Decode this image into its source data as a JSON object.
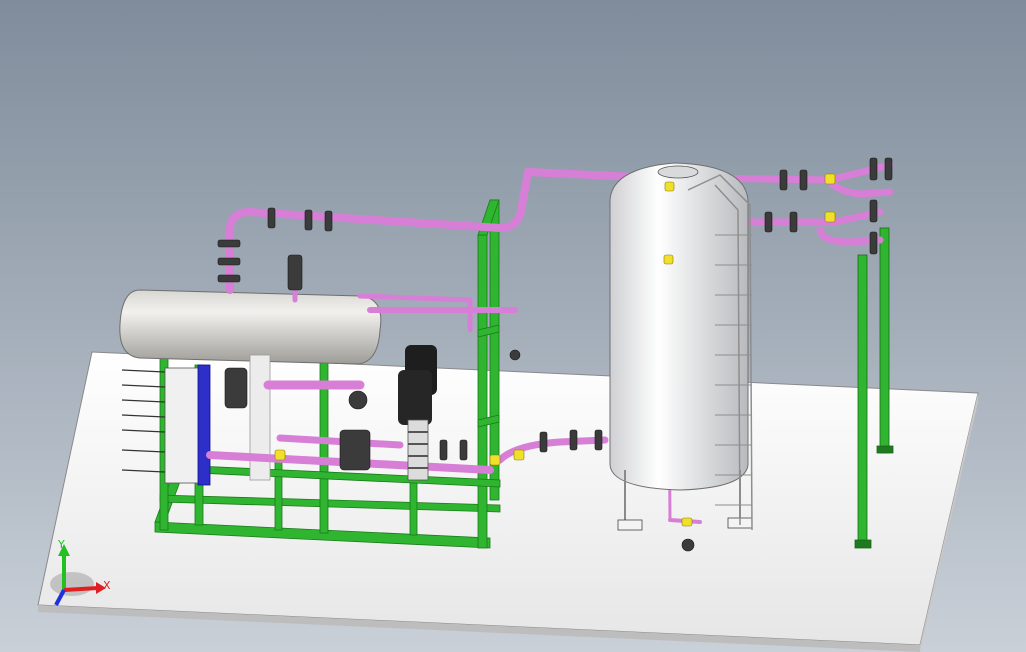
{
  "viewport": {
    "background_top": "#7f8c9b",
    "background_bottom": "#c9d0d8"
  },
  "colors": {
    "skid_frame": "#2fb52f",
    "pipe": "#d77fd6",
    "tank": "#e9eaec",
    "horizontal_vessel": "#c9c7c2",
    "heat_exchanger_plates": "#2e2fc9",
    "pump": "#1e1e1e",
    "flange": "#4a4a4a",
    "valve_highlight": "#f1e02a",
    "base_plate": "#f3f3f3"
  },
  "triad": {
    "y_label": "Y",
    "x_label": "X",
    "y_color": "#22c022",
    "x_color": "#e02020",
    "z_color": "#2030e0"
  }
}
